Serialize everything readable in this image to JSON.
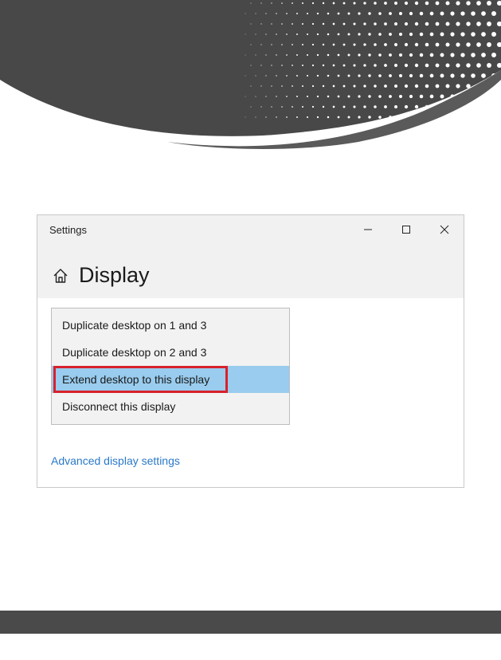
{
  "window": {
    "title": "Settings",
    "controls": [
      "minimize-icon",
      "maximize-icon",
      "close-icon"
    ]
  },
  "page": {
    "icon": "home-icon",
    "heading": "Display"
  },
  "dropdown": {
    "options": [
      "Duplicate desktop on 1 and 3",
      "Duplicate desktop on 2 and 3",
      "Extend desktop to this display",
      "Disconnect this display"
    ],
    "selected_index": 2
  },
  "link": {
    "advanced": "Advanced display settings"
  },
  "colors": {
    "selected_bg": "#99ccee",
    "highlight_border": "#d8212c",
    "link": "#2a79c8",
    "header_dark": "#4a4a4a"
  }
}
